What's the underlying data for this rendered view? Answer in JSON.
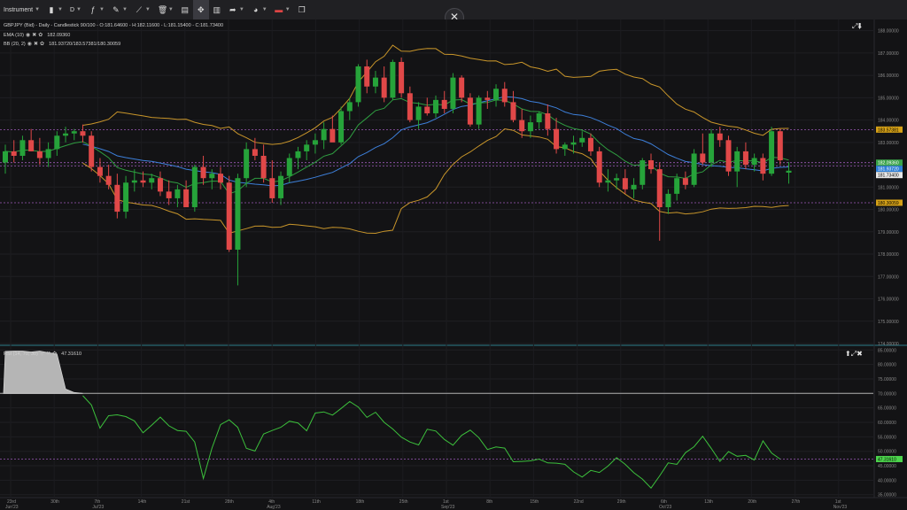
{
  "toolbar": {
    "instrument_label": "Instrument",
    "timeframe_label": "D",
    "items": [
      {
        "name": "instrument-menu",
        "icon": "",
        "label": "Instrument"
      },
      {
        "name": "chart-type-icon",
        "icon": "candles"
      },
      {
        "name": "timeframe-menu",
        "icon": "",
        "label": "D"
      },
      {
        "name": "indicators-icon",
        "icon": "indicator"
      },
      {
        "name": "drawing-tools-icon",
        "icon": "pencil"
      },
      {
        "name": "trend-tools-icon",
        "icon": "lines"
      },
      {
        "name": "delete-icon",
        "icon": "trash"
      },
      {
        "name": "layout-icon",
        "icon": "layout"
      },
      {
        "name": "crosshair-icon",
        "icon": "crosshair"
      },
      {
        "name": "bar-chart-icon",
        "icon": "bars"
      },
      {
        "name": "share-icon",
        "icon": "share"
      },
      {
        "name": "theme-icon",
        "icon": "palette"
      },
      {
        "name": "language-flag-icon",
        "icon": "flag"
      },
      {
        "name": "windows-icon",
        "icon": "windows"
      }
    ],
    "close_symbol": "✕"
  },
  "main_pane": {
    "header": "GBPJPY (Bid) - Daily - Candlestick  90/100 - O:181.64600 - H:182.11600 - L:181.15400 - C:181.73400",
    "ema_label": "EMA (10)",
    "ema_value": "182.09360",
    "bb_label": "BB (20, 2)",
    "bb_value": "181.93720/183.57381/180.30059",
    "price_ticks": [
      "188.00000",
      "187.00000",
      "186.00000",
      "185.00000",
      "184.00000",
      "183.00000",
      "182.00000",
      "181.00000",
      "180.00000",
      "179.00000",
      "178.00000",
      "177.00000",
      "176.00000",
      "175.00000",
      "174.00000"
    ],
    "tags": [
      {
        "text": "183.57381",
        "value": 183.57381,
        "bg": "#d4a017",
        "fg": "#000000"
      },
      {
        "text": "182.09360",
        "value": 182.0936,
        "bg": "#3aa34a",
        "fg": "#ffffff"
      },
      {
        "text": "181.93720",
        "value": 181.9372,
        "bg": "#2f7fd6",
        "fg": "#ffffff"
      },
      {
        "text": "181.73400",
        "value": 181.734,
        "bg": "#e8e8e8",
        "fg": "#000000"
      },
      {
        "text": "180.30059",
        "value": 180.30059,
        "bg": "#d4a017",
        "fg": "#000000"
      }
    ]
  },
  "rsi_pane": {
    "header": "RSI (14, 70, 30)",
    "value": "47.31610",
    "ticks": [
      "85.00000",
      "80.00000",
      "75.00000",
      "70.00000",
      "65.00000",
      "60.00000",
      "55.00000",
      "50.00000",
      "45.00000",
      "40.00000",
      "35.00000"
    ],
    "tag": {
      "text": "47.31610",
      "value": 47.3161,
      "bg": "#4cd44c",
      "fg": "#000000"
    }
  },
  "time_axis": {
    "labels": [
      {
        "t": "23rd",
        "s": "Jun'23"
      },
      {
        "t": "30th",
        "s": ""
      },
      {
        "t": "7th",
        "s": "Jul'23"
      },
      {
        "t": "14th",
        "s": ""
      },
      {
        "t": "21st",
        "s": ""
      },
      {
        "t": "28th",
        "s": ""
      },
      {
        "t": "4th",
        "s": "Aug'23"
      },
      {
        "t": "11th",
        "s": ""
      },
      {
        "t": "18th",
        "s": ""
      },
      {
        "t": "25th",
        "s": ""
      },
      {
        "t": "1st",
        "s": "Sep'23"
      },
      {
        "t": "8th",
        "s": ""
      },
      {
        "t": "15th",
        "s": ""
      },
      {
        "t": "22nd",
        "s": ""
      },
      {
        "t": "29th",
        "s": ""
      },
      {
        "t": "6th",
        "s": "Oct'23"
      },
      {
        "t": "13th",
        "s": ""
      },
      {
        "t": "20th",
        "s": ""
      },
      {
        "t": "27th",
        "s": ""
      },
      {
        "t": "1st",
        "s": "Nov'23"
      }
    ]
  },
  "colors": {
    "bull": "#26a33a",
    "bear": "#e04848",
    "ema": "#2f9e41",
    "bb_mid": "#3d7fd9",
    "bb_band": "#c8952a",
    "guide": "#9b59b6",
    "rsi": "#3cc03c",
    "rsi_mid": "#b0b0b0"
  },
  "chart_data": {
    "type": "candlestick",
    "symbol": "GBPJPY",
    "ylim": [
      174,
      188.5
    ],
    "candles": [
      [
        182.1,
        182.9,
        181.6,
        182.6
      ],
      [
        182.6,
        183.1,
        182.1,
        182.4
      ],
      [
        182.4,
        183.3,
        182.2,
        183.1
      ],
      [
        183.1,
        183.6,
        182.6,
        182.6
      ],
      [
        182.6,
        183.2,
        182.0,
        182.3
      ],
      [
        182.3,
        183.0,
        181.9,
        182.7
      ],
      [
        182.7,
        183.5,
        182.4,
        183.3
      ],
      [
        183.3,
        183.7,
        183.0,
        183.4
      ],
      [
        183.4,
        183.6,
        183.1,
        183.5
      ],
      [
        183.5,
        183.8,
        183.0,
        183.3
      ],
      [
        183.3,
        183.5,
        181.7,
        181.9
      ],
      [
        181.9,
        182.3,
        181.2,
        181.5
      ],
      [
        181.5,
        182.0,
        180.9,
        181.1
      ],
      [
        181.1,
        181.6,
        179.6,
        179.9
      ],
      [
        179.9,
        181.5,
        179.6,
        181.2
      ],
      [
        181.2,
        181.8,
        180.8,
        181.3
      ],
      [
        181.3,
        181.7,
        181.0,
        181.2
      ],
      [
        181.2,
        181.6,
        180.9,
        181.4
      ],
      [
        181.4,
        181.7,
        180.6,
        180.8
      ],
      [
        180.8,
        181.3,
        180.2,
        180.5
      ],
      [
        180.5,
        181.1,
        180.1,
        180.9
      ],
      [
        180.9,
        181.3,
        180.4,
        180.1
      ],
      [
        180.1,
        182.0,
        179.9,
        181.9
      ],
      [
        181.9,
        182.4,
        181.1,
        181.4
      ],
      [
        181.4,
        181.8,
        180.9,
        181.6
      ],
      [
        181.6,
        181.9,
        180.9,
        181.2
      ],
      [
        181.2,
        181.5,
        178.1,
        178.2
      ],
      [
        178.2,
        181.6,
        176.6,
        181.4
      ],
      [
        181.4,
        183.0,
        181.0,
        182.7
      ],
      [
        182.7,
        183.2,
        182.2,
        182.4
      ],
      [
        182.4,
        182.9,
        181.2,
        181.4
      ],
      [
        181.4,
        182.2,
        180.3,
        180.5
      ],
      [
        180.5,
        181.7,
        180.2,
        181.5
      ],
      [
        181.5,
        182.5,
        181.2,
        182.3
      ],
      [
        182.3,
        182.8,
        181.8,
        182.6
      ],
      [
        182.6,
        183.1,
        182.2,
        182.9
      ],
      [
        182.9,
        183.4,
        182.5,
        183.1
      ],
      [
        183.1,
        183.9,
        182.7,
        183.6
      ],
      [
        183.6,
        184.2,
        183.2,
        183.0
      ],
      [
        183.0,
        184.6,
        182.9,
        184.4
      ],
      [
        184.4,
        185.0,
        184.0,
        184.8
      ],
      [
        184.8,
        186.5,
        184.6,
        186.4
      ],
      [
        186.4,
        186.7,
        185.2,
        185.5
      ],
      [
        185.5,
        186.2,
        185.2,
        185.9
      ],
      [
        185.9,
        186.4,
        184.8,
        185.0
      ],
      [
        185.0,
        186.7,
        184.9,
        186.6
      ],
      [
        186.6,
        186.8,
        185.0,
        185.2
      ],
      [
        185.2,
        185.5,
        183.9,
        184.0
      ],
      [
        184.0,
        184.8,
        183.6,
        184.6
      ],
      [
        184.6,
        185.0,
        184.2,
        184.3
      ],
      [
        184.3,
        185.1,
        184.1,
        184.9
      ],
      [
        184.9,
        185.3,
        184.3,
        184.5
      ],
      [
        184.5,
        186.1,
        184.3,
        185.9
      ],
      [
        185.9,
        186.0,
        184.8,
        185.0
      ],
      [
        185.0,
        185.2,
        183.7,
        183.8
      ],
      [
        183.8,
        185.1,
        183.6,
        185.0
      ],
      [
        185.0,
        185.3,
        184.5,
        184.9
      ],
      [
        184.9,
        185.6,
        184.6,
        185.4
      ],
      [
        185.4,
        185.7,
        184.6,
        184.8
      ],
      [
        184.8,
        185.3,
        183.9,
        184.0
      ],
      [
        184.0,
        184.5,
        183.2,
        183.5
      ],
      [
        183.5,
        184.2,
        183.2,
        183.9
      ],
      [
        183.9,
        184.4,
        183.6,
        184.3
      ],
      [
        184.3,
        184.7,
        183.3,
        183.6
      ],
      [
        183.6,
        184.1,
        182.5,
        182.7
      ],
      [
        182.7,
        183.0,
        182.4,
        182.9
      ],
      [
        182.9,
        183.3,
        182.5,
        183.0
      ],
      [
        183.0,
        183.5,
        182.8,
        183.2
      ],
      [
        183.2,
        183.4,
        182.4,
        182.6
      ],
      [
        182.6,
        182.8,
        181.0,
        181.2
      ],
      [
        181.2,
        181.8,
        180.8,
        181.3
      ],
      [
        181.3,
        181.6,
        180.9,
        181.4
      ],
      [
        181.4,
        181.8,
        180.7,
        180.9
      ],
      [
        180.9,
        181.4,
        180.5,
        181.1
      ],
      [
        181.1,
        182.3,
        180.9,
        182.2
      ],
      [
        182.2,
        182.5,
        181.6,
        181.8
      ],
      [
        181.8,
        182.1,
        178.6,
        180.1
      ],
      [
        180.1,
        180.9,
        179.8,
        180.7
      ],
      [
        180.7,
        181.6,
        180.4,
        181.4
      ],
      [
        181.4,
        181.7,
        180.9,
        181.1
      ],
      [
        181.1,
        182.7,
        181.0,
        182.5
      ],
      [
        182.5,
        183.4,
        182.0,
        182.1
      ],
      [
        182.1,
        183.6,
        181.9,
        183.4
      ],
      [
        183.4,
        183.7,
        182.8,
        183.1
      ],
      [
        183.1,
        183.3,
        181.5,
        181.7
      ],
      [
        181.7,
        182.8,
        181.0,
        182.6
      ],
      [
        182.6,
        183.0,
        181.8,
        182.0
      ],
      [
        182.0,
        182.5,
        181.7,
        182.3
      ],
      [
        182.3,
        182.5,
        181.3,
        181.6
      ],
      [
        181.6,
        183.7,
        181.5,
        183.5
      ],
      [
        183.5,
        183.6,
        182.0,
        182.2
      ],
      [
        181.646,
        182.116,
        181.154,
        181.734
      ]
    ],
    "rsi": [
      84.5,
      84.6,
      84.6,
      84.3,
      84.6,
      84.1,
      83.6,
      71.5,
      70.3,
      69.2,
      66.0,
      58.0,
      62.3,
      62.6,
      62.0,
      60.5,
      56.4,
      59.0,
      61.8,
      58.8,
      57.2,
      56.9,
      53.2,
      40.6,
      51.1,
      59.2,
      60.9,
      58.3,
      51.0,
      50.1,
      56.0,
      57.2,
      58.3,
      60.4,
      59.8,
      57.1,
      63.2,
      63.6,
      62.5,
      64.8,
      67.2,
      65.3,
      61.7,
      63.5,
      60.0,
      57.7,
      54.9,
      53.2,
      52.2,
      57.6,
      57.0,
      54.1,
      52.1,
      55.5,
      57.3,
      54.7,
      50.6,
      51.5,
      51.1,
      46.4,
      46.5,
      46.7,
      47.3,
      46.0,
      45.9,
      45.5,
      42.9,
      41.1,
      43.4,
      42.7,
      44.9,
      47.8,
      45.5,
      42.6,
      40.4,
      37.3,
      41.5,
      46.0,
      45.5,
      49.5,
      51.6,
      55.2,
      51.0,
      46.5,
      49.9,
      48.3,
      48.6,
      47.0,
      53.6,
      49.4,
      47.3
    ],
    "rsi_levels": [
      70,
      50,
      30
    ],
    "rsi_ylim": [
      34,
      86
    ]
  }
}
